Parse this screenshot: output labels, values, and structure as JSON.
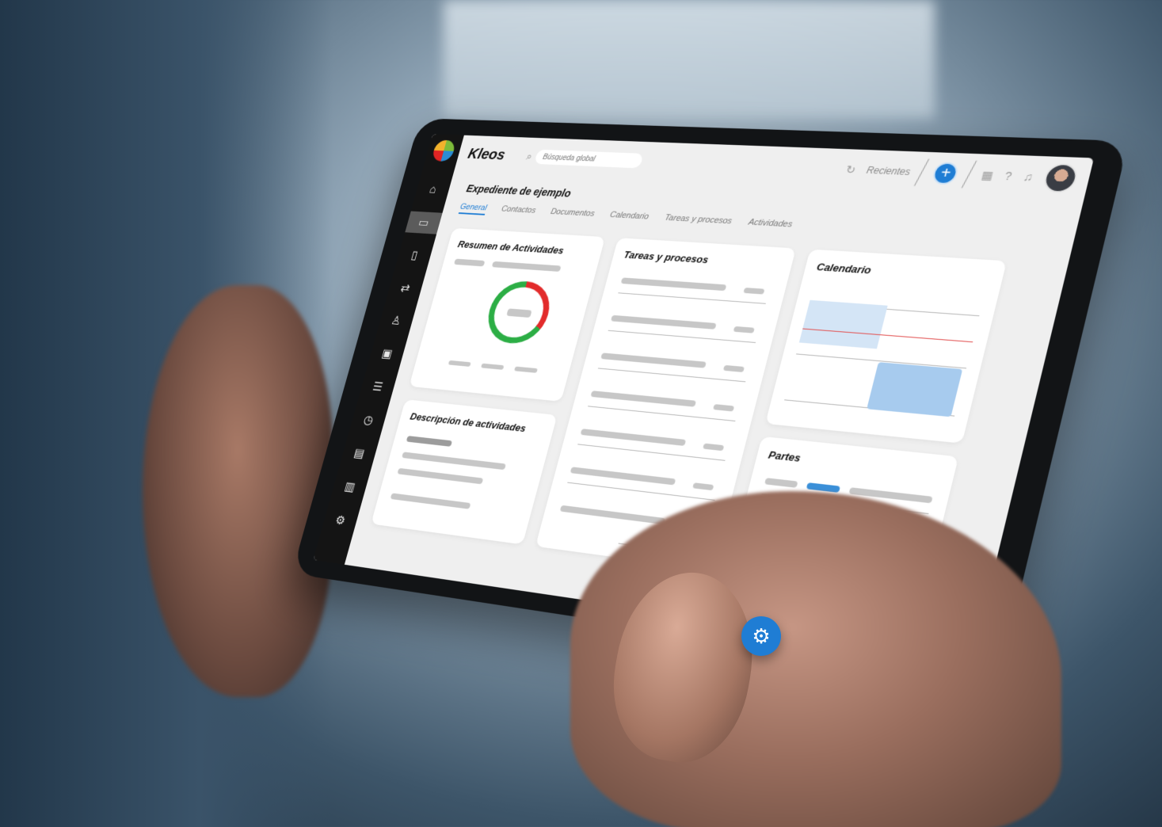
{
  "app": {
    "name": "Kleos"
  },
  "search": {
    "placeholder": "Búsqueda global"
  },
  "header": {
    "recent_label": "Recientes",
    "add_label": "+"
  },
  "page": {
    "title": "Expediente de ejemplo"
  },
  "tabs": [
    {
      "label": "General",
      "active": true
    },
    {
      "label": "Contactos",
      "active": false
    },
    {
      "label": "Documentos",
      "active": false
    },
    {
      "label": "Calendario",
      "active": false
    },
    {
      "label": "Tareas y procesos",
      "active": false
    },
    {
      "label": "Actividades",
      "active": false
    }
  ],
  "sidebar": {
    "icons": [
      "home-icon",
      "folder-icon",
      "document-icon",
      "transfer-icon",
      "contact-icon",
      "calendar-gift-icon",
      "checklist-icon",
      "stopwatch-icon",
      "ledger-icon",
      "chart-icon",
      "settings-icon"
    ]
  },
  "cards": {
    "activity_summary": {
      "title": "Resumen de Actividades"
    },
    "activity_description": {
      "title": "Descripción de actividades"
    },
    "tasks": {
      "title": "Tareas y procesos"
    },
    "calendar": {
      "title": "Calendario"
    },
    "parties": {
      "title": "Partes"
    }
  },
  "colors": {
    "accent": "#1f7dd4",
    "donut_green": "#2cae45",
    "donut_red": "#e22b2b"
  },
  "fab": {
    "icon": "gear-icon"
  }
}
